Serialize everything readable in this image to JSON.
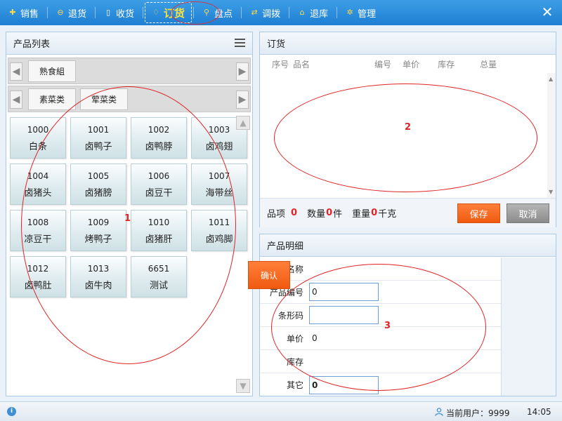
{
  "nav": {
    "items": [
      {
        "label": "销售",
        "icon": "plus-circle-icon"
      },
      {
        "label": "退货",
        "icon": "minus-circle-icon"
      },
      {
        "label": "收货",
        "icon": "document-icon"
      },
      {
        "label": "订货",
        "icon": "order-icon"
      },
      {
        "label": "盘点",
        "icon": "search-icon"
      },
      {
        "label": "调拨",
        "icon": "transfer-icon"
      },
      {
        "label": "退库",
        "icon": "home-icon"
      },
      {
        "label": "管理",
        "icon": "gear-icon"
      }
    ],
    "active_index": 3,
    "close_label": "✕"
  },
  "product_list": {
    "title": "产品列表",
    "category_row1": [
      "熟食組"
    ],
    "category_row2": [
      "素菜类",
      "荤菜类"
    ],
    "products": [
      {
        "code": "1000",
        "name": "白条"
      },
      {
        "code": "1001",
        "name": "卤鸭子"
      },
      {
        "code": "1002",
        "name": "卤鸭脖"
      },
      {
        "code": "1003",
        "name": "卤鸡翅"
      },
      {
        "code": "1004",
        "name": "卤猪头"
      },
      {
        "code": "1005",
        "name": "卤猪膀"
      },
      {
        "code": "1006",
        "name": "卤豆干"
      },
      {
        "code": "1007",
        "name": "海带丝"
      },
      {
        "code": "1008",
        "name": "凉豆干"
      },
      {
        "code": "1009",
        "name": "烤鸭子"
      },
      {
        "code": "1010",
        "name": "卤猪肝"
      },
      {
        "code": "1011",
        "name": "卤鸡脚"
      },
      {
        "code": "1012",
        "name": "卤鸭肚"
      },
      {
        "code": "1013",
        "name": "卤牛肉"
      },
      {
        "code": "6651",
        "name": "测试"
      }
    ]
  },
  "order": {
    "title": "订货",
    "columns": {
      "seq": "序号",
      "name": "品名",
      "code": "编号",
      "price": "单价",
      "stock": "库存",
      "total": "总量"
    },
    "footer": {
      "items_label": "品项",
      "items_value": "0",
      "qty_label": "数量",
      "qty_value": "0",
      "qty_unit": "件",
      "weight_label": "重量",
      "weight_value": "0",
      "weight_unit": "千克"
    },
    "save_label": "保存",
    "cancel_label": "取消"
  },
  "detail": {
    "title": "产品明细",
    "name_label": "产品名称",
    "code_label": "产品编号",
    "code_value": "0",
    "barcode_label": "条形码",
    "barcode_value": "",
    "price_label": "单价",
    "price_value": "0",
    "stock_label": "库存",
    "other_label": "其它",
    "other_value": "0",
    "confirm_label": "确认"
  },
  "status": {
    "user_label": "当前用户：9999",
    "time": "14:05"
  },
  "annotations": [
    "1",
    "2",
    "3"
  ]
}
